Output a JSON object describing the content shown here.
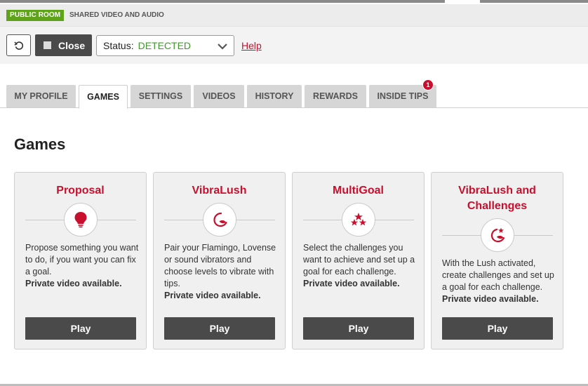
{
  "header": {
    "room_badge": "PUBLIC ROOM",
    "room_description": "SHARED VIDEO AND AUDIO"
  },
  "controls": {
    "refresh_icon": "refresh-icon",
    "close_label": "Close",
    "status_label": "Status:",
    "status_value": "DETECTED",
    "help_label": "Help"
  },
  "tabs": [
    {
      "label": "MY PROFILE",
      "active": false
    },
    {
      "label": "GAMES",
      "active": true
    },
    {
      "label": "SETTINGS",
      "active": false
    },
    {
      "label": "VIDEOS",
      "active": false
    },
    {
      "label": "HISTORY",
      "active": false
    },
    {
      "label": "REWARDS",
      "active": false
    },
    {
      "label": "INSIDE TIPS",
      "active": false,
      "badge": "1"
    }
  ],
  "page_title": "Games",
  "games": [
    {
      "title": "Proposal",
      "icon": "lightbulb-icon",
      "description": "Propose something you want to do, if you want you can fix a goal.",
      "note": "Private video available.",
      "play_label": "Play"
    },
    {
      "title": "VibraLush",
      "icon": "vibrator-icon",
      "description": "Pair your Flamingo, Lovense or sound vibrators and choose levels to vibrate with tips.",
      "note": "Private video available.",
      "play_label": "Play"
    },
    {
      "title": "MultiGoal",
      "icon": "stars-icon",
      "description": "Select the challenges you want to achieve and set up a goal for each challenge.",
      "note": "Private video available.",
      "play_label": "Play"
    },
    {
      "title_line1": "VibraLush and",
      "title_line2": "Challenges",
      "icon": "vibrator-star-icon",
      "description": "With the Lush activated, create challenges and set up a goal for each challenge.",
      "note": "Private video available.",
      "play_label": "Play"
    }
  ],
  "colors": {
    "accent": "#c8102e",
    "badge_green": "#5fa31a",
    "status_green": "#3d9a2a",
    "dark_button": "#4a4a4a"
  }
}
